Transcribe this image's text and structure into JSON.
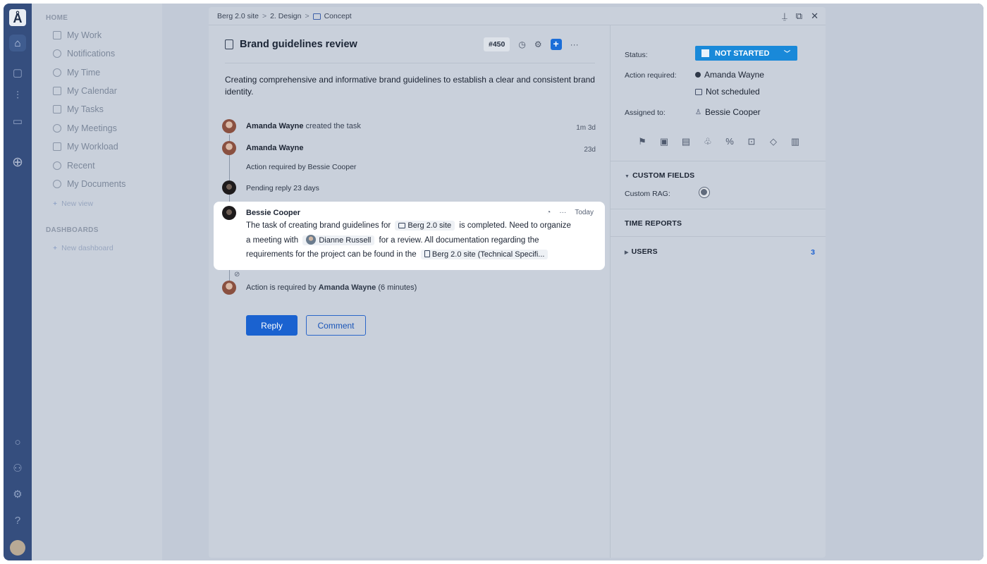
{
  "nav": {
    "home_heading": "HOME",
    "items": [
      "My Work",
      "Notifications",
      "My Time",
      "My Calendar",
      "My Tasks",
      "My Meetings",
      "My Workload",
      "Recent",
      "My Documents"
    ],
    "new_view": "New view",
    "dashboards_heading": "DASHBOARDS",
    "new_dashboard": "New dashboard"
  },
  "breadcrumb": {
    "project": "Berg 2.0 site",
    "folder": "2. Design",
    "page": "Concept",
    "separator": ">"
  },
  "task": {
    "title": "Brand guidelines review",
    "id": "#450",
    "description": "Creating comprehensive and informative brand guidelines to establish a clear and consistent brand identity."
  },
  "activity": {
    "a1": {
      "name": "Amanda Wayne",
      "action": "created the task",
      "time": "1m 3d"
    },
    "a2": {
      "name": "Amanda Wayne",
      "time": "23d",
      "sub": "Action required by Bessie Cooper"
    },
    "a3": {
      "text": "Pending reply 23 days"
    },
    "comment": {
      "name": "Bessie Cooper",
      "time": "Today",
      "p1": "The task of creating brand guidelines for",
      "chip_project": "Berg 2.0 site",
      "p2": "is completed. Need to organize a meeting with",
      "chip_person": "Dianne Russell",
      "p3": "for a review. All documentation regarding the requirements for the project can be found in the",
      "chip_doc": "Berg 2.0 site (Technical Specifi..."
    },
    "a4": {
      "prefix": "Action is required by",
      "name": "Amanda Wayne",
      "suffix": "(6 minutes)"
    }
  },
  "buttons": {
    "reply": "Reply",
    "comment": "Comment"
  },
  "side": {
    "status_label": "Status:",
    "status_value": "NOT STARTED",
    "action_label": "Action required:",
    "action_user": "Amanda Wayne",
    "action_date": "Not scheduled",
    "assigned_label": "Assigned to:",
    "assigned_user": "Bessie Cooper",
    "custom_fields": "CUSTOM FIELDS",
    "custom_rag": "Custom RAG:",
    "time_reports": "TIME REPORTS",
    "users": "USERS",
    "users_count": "3"
  },
  "colors": {
    "accent": "#1a62d0",
    "status": "#1989d9",
    "rail": "#354e7e"
  }
}
